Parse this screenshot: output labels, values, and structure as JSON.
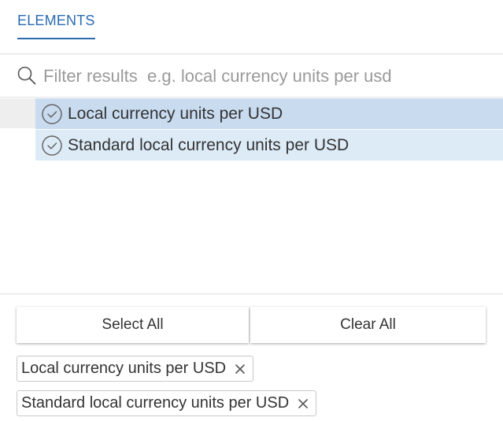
{
  "tabs": [
    {
      "label": "ELEMENTS",
      "active": true
    }
  ],
  "filter": {
    "placeholder": "Filter results  e.g. local currency units per usd",
    "value": ""
  },
  "results": [
    {
      "label": "Local currency units per USD",
      "selected": true
    },
    {
      "label": "Standard local currency units per USD",
      "selected": true
    }
  ],
  "actions": {
    "select_all": "Select All",
    "clear_all": "Clear All"
  },
  "selected_chips": [
    {
      "label": "Local currency units per USD"
    },
    {
      "label": "Standard local currency units per USD"
    }
  ],
  "colors": {
    "accent": "#2b6cb0",
    "row_highlight": "#c8dbef",
    "row_selected": "#ddebf7"
  },
  "icons": {
    "search": "search-icon",
    "check": "check-circle-icon",
    "remove": "close-icon"
  }
}
